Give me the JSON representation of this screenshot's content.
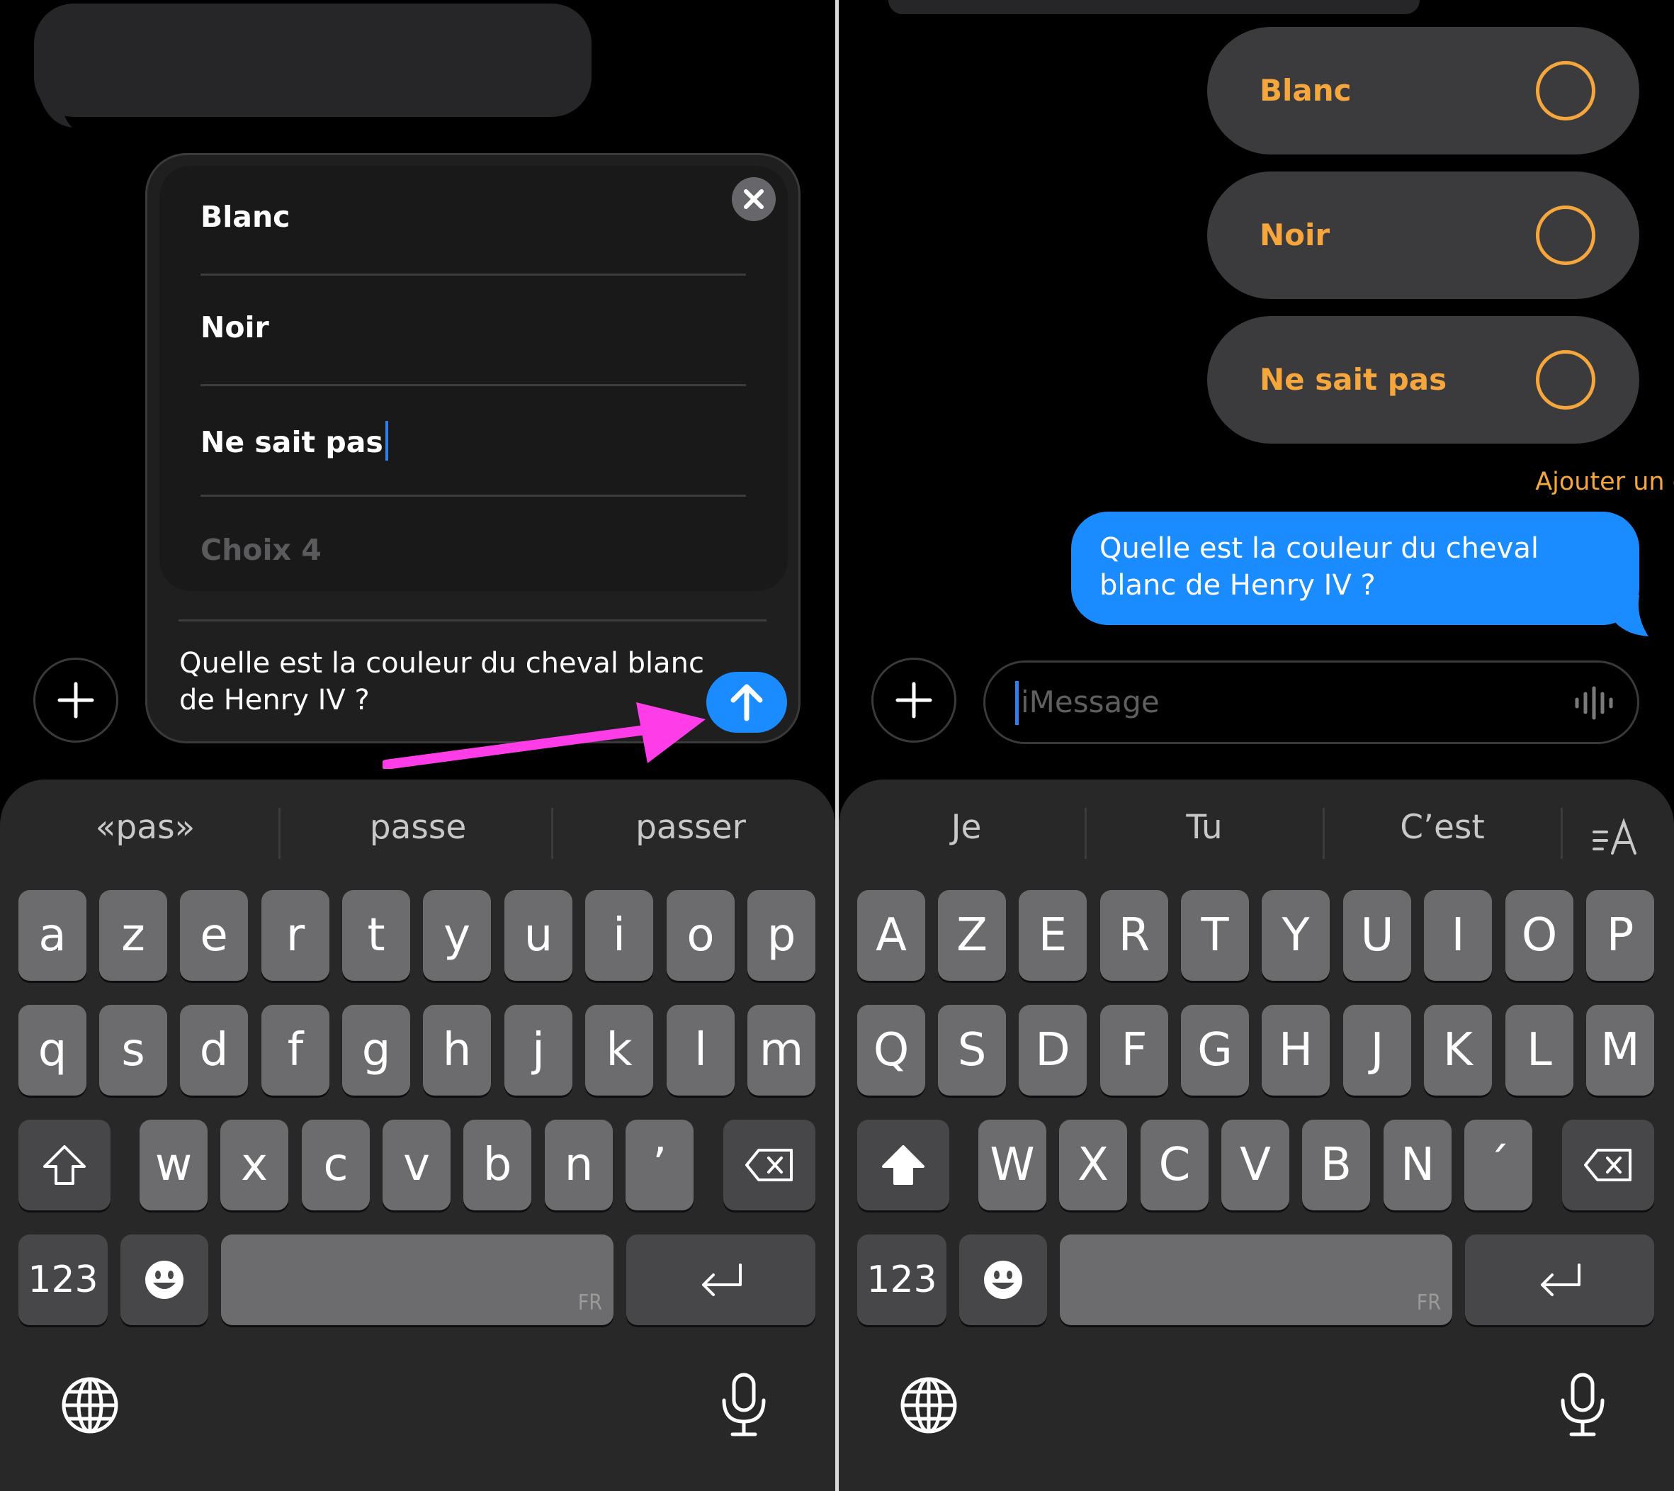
{
  "left": {
    "poll_editor": {
      "choices": [
        "Blanc",
        "Noir",
        "Ne sait pas"
      ],
      "choice_placeholder": "Choix 4",
      "question": "Quelle est la couleur du cheval blanc de Henry IV ?"
    },
    "keyboard": {
      "suggestions": [
        "«pas»",
        "passe",
        "passer"
      ],
      "row1": [
        "a",
        "z",
        "e",
        "r",
        "t",
        "y",
        "u",
        "i",
        "o",
        "p"
      ],
      "row2": [
        "q",
        "s",
        "d",
        "f",
        "g",
        "h",
        "j",
        "k",
        "l",
        "m"
      ],
      "row3": [
        "w",
        "x",
        "c",
        "v",
        "b",
        "n",
        "’"
      ],
      "numbers_label": "123",
      "space_lang": "FR"
    }
  },
  "right": {
    "poll": {
      "options": [
        "Blanc",
        "Noir",
        "Ne sait pas"
      ],
      "add_choice": "Ajouter un choix"
    },
    "sent_message": "Quelle est la couleur du cheval blanc de Henry IV ?",
    "message_field": {
      "placeholder": "iMessage"
    },
    "keyboard": {
      "suggestions": [
        "Je",
        "Tu",
        "C’est"
      ],
      "row1": [
        "A",
        "Z",
        "E",
        "R",
        "T",
        "Y",
        "U",
        "I",
        "O",
        "P"
      ],
      "row2": [
        "Q",
        "S",
        "D",
        "F",
        "G",
        "H",
        "J",
        "K",
        "L",
        "M"
      ],
      "row3": [
        "W",
        "X",
        "C",
        "V",
        "B",
        "N",
        "´"
      ],
      "numbers_label": "123",
      "space_lang": "FR"
    }
  },
  "colors": {
    "accent_blue": "#1a8cff",
    "poll_orange": "#f5a63c",
    "annotation_arrow": "#ff3de8",
    "key": "#6c6c6e",
    "function_key": "#474749",
    "keyboard_bg": "#282828"
  },
  "icons": [
    "close-icon",
    "plus-icon",
    "arrow-up-icon",
    "shift-icon",
    "delete-icon",
    "emoji-icon",
    "return-icon",
    "globe-icon",
    "microphone-icon",
    "waveform-icon",
    "text-format-icon"
  ]
}
